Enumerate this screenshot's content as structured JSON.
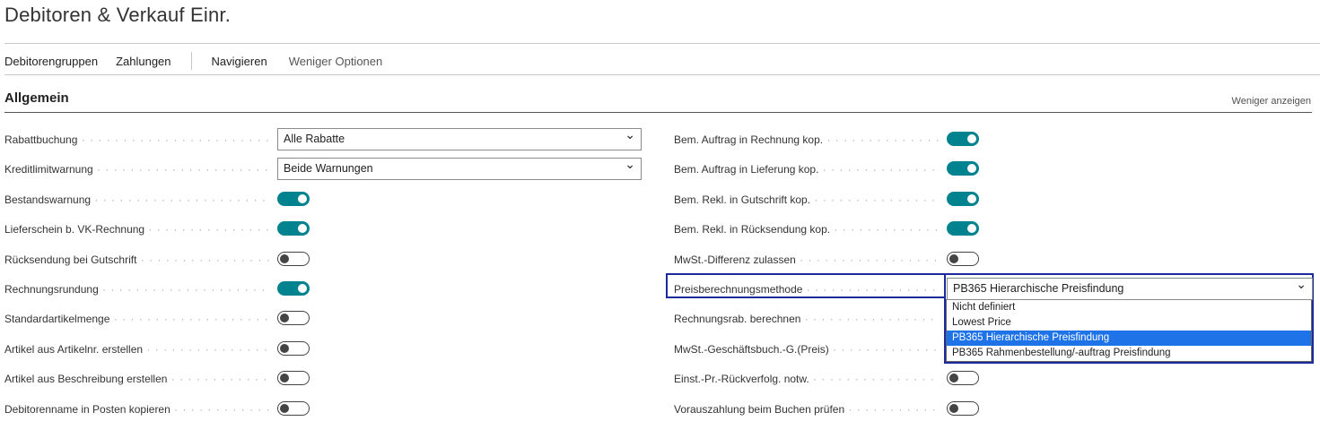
{
  "page": {
    "title": "Debitoren & Verkauf Einr."
  },
  "actions": [
    "Debitorengruppen",
    "Zahlungen",
    "Navigieren",
    "Weniger Optionen"
  ],
  "section": {
    "title": "Allgemein",
    "toggle_label": "Weniger anzeigen"
  },
  "left_fields": [
    {
      "label": "Rabattbuchung",
      "type": "select",
      "value": "Alle Rabatte"
    },
    {
      "label": "Kreditlimitwarnung",
      "type": "select",
      "value": "Beide Warnungen"
    },
    {
      "label": "Bestandswarnung",
      "type": "toggle",
      "value": true
    },
    {
      "label": "Lieferschein b. VK-Rechnung",
      "type": "toggle",
      "value": true
    },
    {
      "label": "Rücksendung bei Gutschrift",
      "type": "toggle",
      "value": false
    },
    {
      "label": "Rechnungsrundung",
      "type": "toggle",
      "value": true
    },
    {
      "label": "Standardartikelmenge",
      "type": "toggle",
      "value": false
    },
    {
      "label": "Artikel aus Artikelnr. erstellen",
      "type": "toggle",
      "value": false
    },
    {
      "label": "Artikel aus Beschreibung erstellen",
      "type": "toggle",
      "value": false
    },
    {
      "label": "Debitorenname in Posten kopieren",
      "type": "toggle",
      "value": false
    }
  ],
  "right_fields": [
    {
      "label": "Bem. Auftrag in Rechnung kop.",
      "type": "toggle",
      "value": true
    },
    {
      "label": "Bem. Auftrag in Lieferung kop.",
      "type": "toggle",
      "value": true
    },
    {
      "label": "Bem. Rekl. in Gutschrift kop.",
      "type": "toggle",
      "value": true
    },
    {
      "label": "Bem. Rekl. in Rücksendung kop.",
      "type": "toggle",
      "value": true
    },
    {
      "label": "MwSt.-Differenz zulassen",
      "type": "toggle",
      "value": false
    },
    {
      "label": "Preisberechnungsmethode",
      "type": "select",
      "value": "PB365 Hierarchische Preisfindung"
    },
    {
      "label": "Rechnungsrab. berechnen",
      "type": "hidden"
    },
    {
      "label": "MwSt.-Geschäftsbuch.-G.(Preis)",
      "type": "hidden"
    },
    {
      "label": "Einst.-Pr.-Rückverfolg. notw.",
      "type": "toggle",
      "value": false
    },
    {
      "label": "Vorauszahlung beim Buchen prüfen",
      "type": "toggle",
      "value": false
    }
  ],
  "dropdown": {
    "options": [
      "Nicht definiert",
      "Lowest Price",
      "PB365 Hierarchische Preisfindung",
      "PB365 Rahmenbestellung/-auftrag Preisfindung"
    ],
    "selected": 2
  },
  "colors": {
    "accent": "#00838f",
    "focus": "#1d2a9c",
    "highlight": "#1e73e8"
  }
}
